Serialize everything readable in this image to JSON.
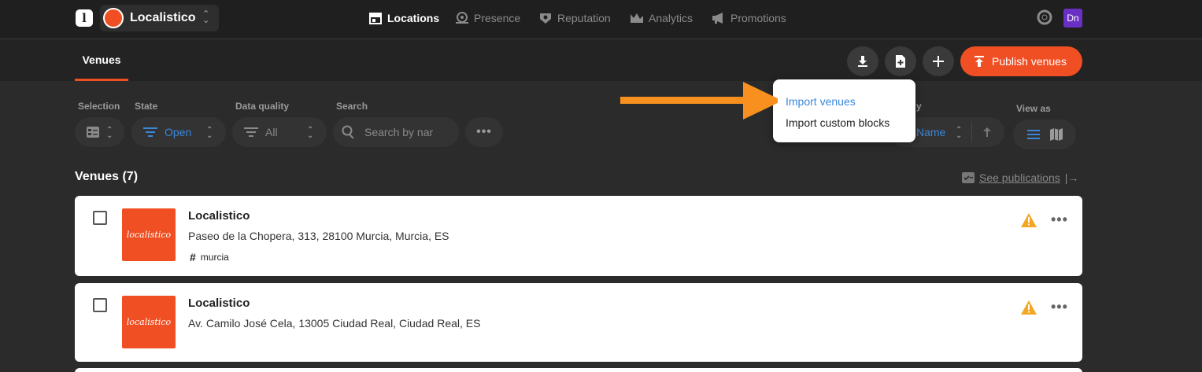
{
  "brand": {
    "logo_letter": "l",
    "org_name": "Localistico",
    "accent": "#f04e23"
  },
  "nav": {
    "locations": "Locations",
    "presence": "Presence",
    "reputation": "Reputation",
    "analytics": "Analytics",
    "promotions": "Promotions"
  },
  "user": {
    "initials": "Dn",
    "color": "#6a2fc4"
  },
  "subbar": {
    "tab_venues": "Venues",
    "publish_label": "Publish venues"
  },
  "filters": {
    "selection_label": "Selection",
    "state_label": "State",
    "state_value": "Open",
    "quality_label": "Data quality",
    "quality_value": "All",
    "search_label": "Search",
    "search_placeholder": "Search by nar",
    "sort_label": "y",
    "sort_value": "Name",
    "viewas_label": "View as"
  },
  "dropdown": {
    "item1": "Import venues",
    "item2": "Import custom blocks"
  },
  "list": {
    "title": "Venues (7)",
    "see_publications": "See publications"
  },
  "venues": [
    {
      "name": "Localistico",
      "address": "Paseo de la Chopera, 313, 28100 Murcia, Murcia, ES",
      "tag": "murcia",
      "logo_text": "localistico"
    },
    {
      "name": "Localistico",
      "address": "Av. Camilo José Cela, 13005 Ciudad Real, Ciudad Real, ES",
      "logo_text": "localistico"
    }
  ]
}
